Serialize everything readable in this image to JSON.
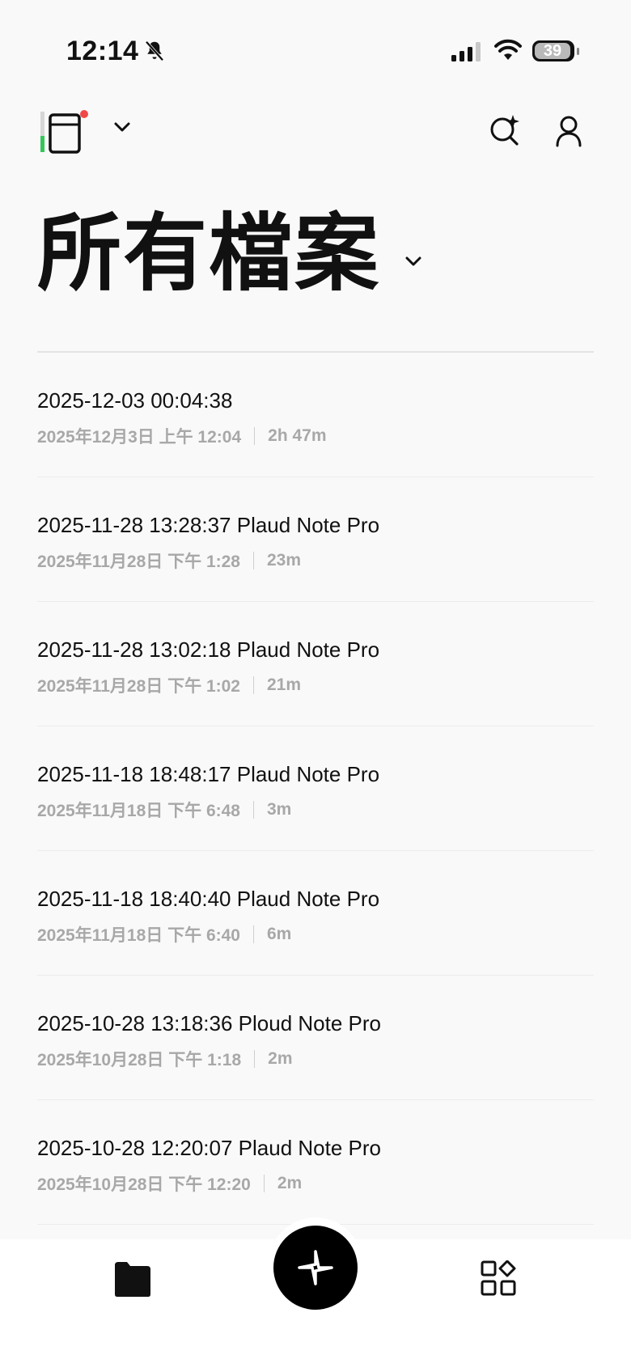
{
  "status_bar": {
    "time": "12:14",
    "battery": "39",
    "icons": [
      "bell-slash-icon",
      "cellular-signal-icon",
      "wifi-icon",
      "battery-icon"
    ]
  },
  "header": {
    "device_icon": "recorder-device-icon",
    "notification_dot_color": "#f04848",
    "ai_search_icon": "ai-search-icon",
    "profile_icon": "profile-icon"
  },
  "page": {
    "title": "所有檔案"
  },
  "recordings": [
    {
      "title": "2025-12-03 00:04:38",
      "date": "2025年12月3日 上午 12:04",
      "duration": "2h 47m"
    },
    {
      "title": "2025-11-28 13:28:37 Plaud Note Pro",
      "date": "2025年11月28日 下午 1:28",
      "duration": "23m"
    },
    {
      "title": "2025-11-28 13:02:18 Plaud Note Pro",
      "date": "2025年11月28日 下午 1:02",
      "duration": "21m"
    },
    {
      "title": "2025-11-18 18:48:17 Plaud Note Pro",
      "date": "2025年11月18日 下午 6:48",
      "duration": "3m"
    },
    {
      "title": "2025-11-18 18:40:40 Plaud Note Pro",
      "date": "2025年11月18日 下午 6:40",
      "duration": "6m"
    },
    {
      "title": "2025-10-28 13:18:36 Ploud Note Pro",
      "date": "2025年10月28日 下午 1:18",
      "duration": "2m"
    },
    {
      "title": "2025-10-28 12:20:07 Plaud Note Pro",
      "date": "2025年10月28日 下午 12:20",
      "duration": "2m"
    }
  ],
  "bottom_nav": {
    "files_icon": "folder-icon",
    "record_icon": "record-sparkle-icon",
    "apps_icon": "apps-grid-icon"
  }
}
